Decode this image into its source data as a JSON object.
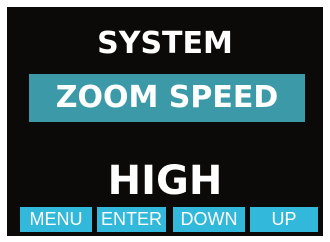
{
  "screen": {
    "title": "SYSTEM",
    "selected_item": "ZOOM SPEED",
    "value": "HIGH"
  },
  "buttons": {
    "menu": "MENU",
    "enter": "ENTER",
    "down": "DOWN",
    "up": "UP"
  },
  "colors": {
    "background": "#0b0a09",
    "highlight": "#3c9aa8",
    "button": "#31b8da",
    "text": "#ffffff"
  }
}
